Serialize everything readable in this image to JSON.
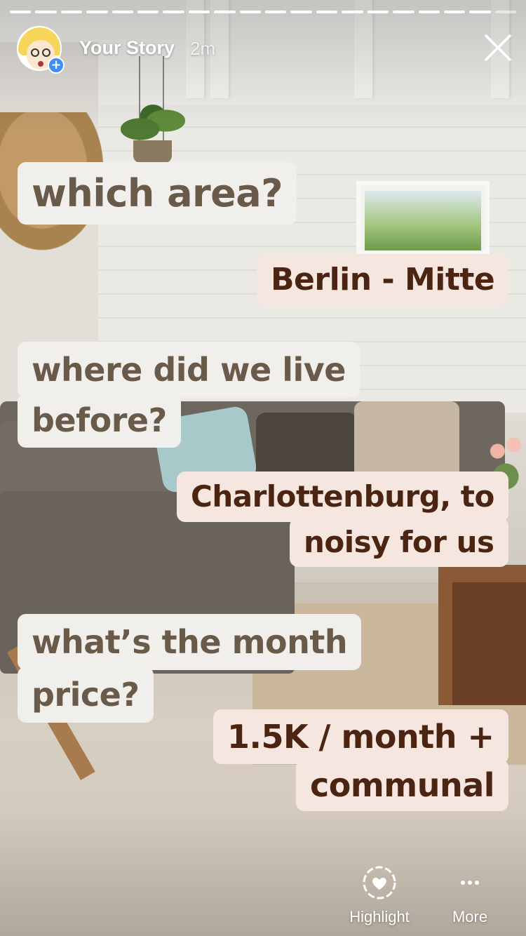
{
  "story": {
    "author": "Your Story",
    "time": "2m",
    "progress_segments": 20,
    "segments_viewed": 19
  },
  "stickers": {
    "q1": [
      "which area?"
    ],
    "a1": [
      "Berlin - Mitte"
    ],
    "q2": [
      "where did we live",
      "before?"
    ],
    "a2": [
      "Charlottenburg, to",
      "noisy for us"
    ],
    "q3": [
      "what’s the month",
      "price?"
    ],
    "a3": [
      "1.5K / month +",
      "communal"
    ]
  },
  "actions": {
    "highlight_label": "Highlight",
    "more_label": "More"
  },
  "icons": {
    "avatar_badge": "plus-icon",
    "close": "close-icon",
    "highlight": "heart-circle-icon",
    "more": "more-dots-icon"
  },
  "colors": {
    "question_bg": "#f1efec",
    "question_text": "#6a5a4a",
    "answer_bg": "#f5e6df",
    "answer_text": "#4b2512",
    "badge_blue": "#3f8ef5"
  }
}
